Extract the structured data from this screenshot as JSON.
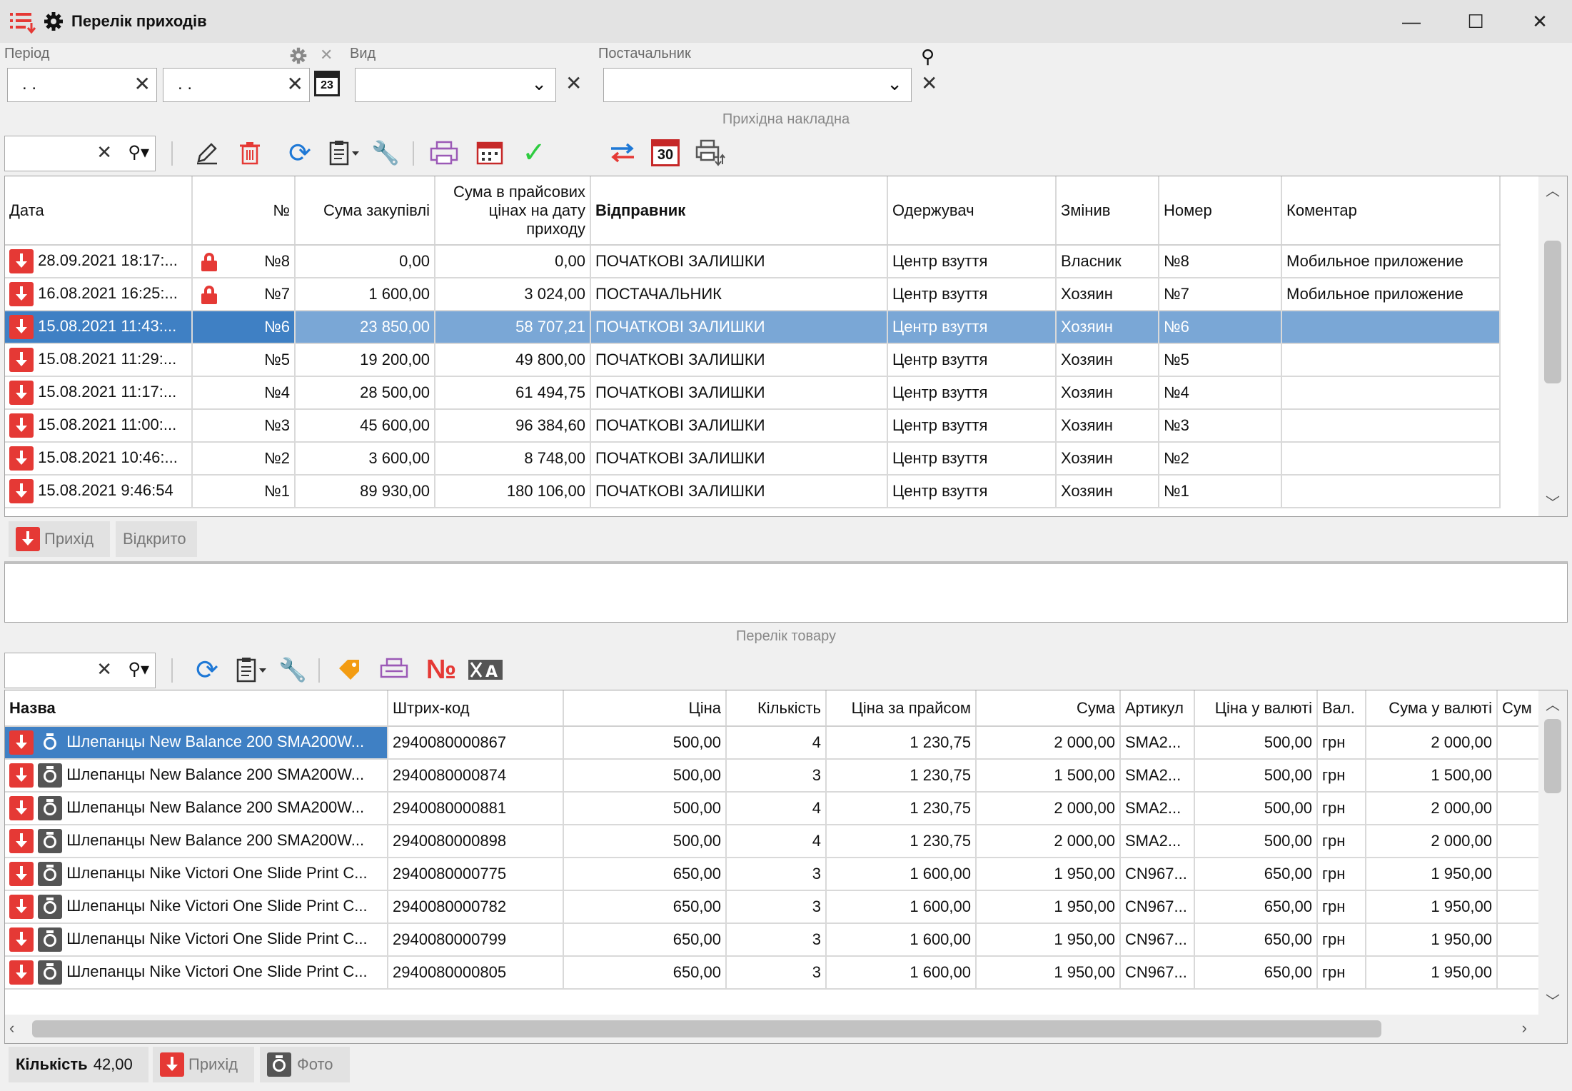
{
  "window": {
    "title": "Перелік приходів"
  },
  "filters": {
    "period_label": "Період",
    "period_from": ". .",
    "period_to": ". .",
    "calendar_day": "23",
    "kind_label": "Вид",
    "kind_value": "",
    "supplier_label": "Постачальник",
    "supplier_value": ""
  },
  "invoice_section": {
    "title": "Прихідна накладна",
    "search_value": "",
    "report_day": "30"
  },
  "invoices": {
    "columns": [
      "Дата",
      "№",
      "Сума закупівлі",
      "Сума в прайсових цінах на дату приходу",
      "Відправник",
      "Одержувач",
      "Змінив",
      "Номер",
      "Коментар"
    ],
    "rows": [
      {
        "date": "28.09.2021 18:17:...",
        "locked": true,
        "no": "№8",
        "purchase": "0,00",
        "price_sum": "0,00",
        "sender": "ПОЧАТКОВІ ЗАЛИШКИ",
        "receiver": "Центр взуття",
        "changed": "Власник",
        "number": "№8",
        "comment": "Мобильное приложение"
      },
      {
        "date": "16.08.2021 16:25:...",
        "locked": true,
        "no": "№7",
        "purchase": "1 600,00",
        "price_sum": "3 024,00",
        "sender": "ПОСТАЧАЛЬНИК",
        "receiver": "Центр взуття",
        "changed": "Хозяин",
        "number": "№7",
        "comment": "Мобильное приложение"
      },
      {
        "date": "15.08.2021 11:43:...",
        "locked": false,
        "selected": true,
        "no": "№6",
        "purchase": "23 850,00",
        "price_sum": "58 707,21",
        "sender": "ПОЧАТКОВІ ЗАЛИШКИ",
        "receiver": "Центр взуття",
        "changed": "Хозяин",
        "number": "№6",
        "comment": ""
      },
      {
        "date": "15.08.2021 11:29:...",
        "locked": false,
        "no": "№5",
        "purchase": "19 200,00",
        "price_sum": "49 800,00",
        "sender": "ПОЧАТКОВІ ЗАЛИШКИ",
        "receiver": "Центр взуття",
        "changed": "Хозяин",
        "number": "№5",
        "comment": ""
      },
      {
        "date": "15.08.2021 11:17:...",
        "locked": false,
        "no": "№4",
        "purchase": "28 500,00",
        "price_sum": "61 494,75",
        "sender": "ПОЧАТКОВІ ЗАЛИШКИ",
        "receiver": "Центр взуття",
        "changed": "Хозяин",
        "number": "№4",
        "comment": ""
      },
      {
        "date": "15.08.2021 11:00:...",
        "locked": false,
        "no": "№3",
        "purchase": "45 600,00",
        "price_sum": "96 384,60",
        "sender": "ПОЧАТКОВІ ЗАЛИШКИ",
        "receiver": "Центр взуття",
        "changed": "Хозяин",
        "number": "№3",
        "comment": ""
      },
      {
        "date": "15.08.2021 10:46:...",
        "locked": false,
        "no": "№2",
        "purchase": "3 600,00",
        "price_sum": "8 748,00",
        "sender": "ПОЧАТКОВІ ЗАЛИШКИ",
        "receiver": "Центр взуття",
        "changed": "Хозяин",
        "number": "№2",
        "comment": ""
      },
      {
        "date": "15.08.2021 9:46:54",
        "locked": false,
        "no": "№1",
        "purchase": "89 930,00",
        "price_sum": "180 106,00",
        "sender": "ПОЧАТКОВІ ЗАЛИШКИ",
        "receiver": "Центр взуття",
        "changed": "Хозяин",
        "number": "№1",
        "comment": ""
      }
    ]
  },
  "invoice_tags": {
    "income": "Прихід",
    "open": "Відкрито"
  },
  "goods_section": {
    "title": "Перелік товару",
    "search_value": ""
  },
  "goods": {
    "columns": [
      "Назва",
      "Штрих-код",
      "Ціна",
      "Кількість",
      "Ціна за прайсом",
      "Сума",
      "Артикул",
      "Ціна у валюті",
      "Вал.",
      "Сума у валюті",
      "Сум"
    ],
    "rows": [
      {
        "name": "Шлепанцы New Balance 200 SMA200W...",
        "barcode": "2940080000867",
        "price": "500,00",
        "qty": "4",
        "list_price": "1 230,75",
        "sum": "2 000,00",
        "article": "SMA2...",
        "cur_price": "500,00",
        "cur": "грн",
        "cur_sum": "2 000,00",
        "selected": true
      },
      {
        "name": "Шлепанцы New Balance 200 SMA200W...",
        "barcode": "2940080000874",
        "price": "500,00",
        "qty": "3",
        "list_price": "1 230,75",
        "sum": "1 500,00",
        "article": "SMA2...",
        "cur_price": "500,00",
        "cur": "грн",
        "cur_sum": "1 500,00"
      },
      {
        "name": "Шлепанцы New Balance 200 SMA200W...",
        "barcode": "2940080000881",
        "price": "500,00",
        "qty": "4",
        "list_price": "1 230,75",
        "sum": "2 000,00",
        "article": "SMA2...",
        "cur_price": "500,00",
        "cur": "грн",
        "cur_sum": "2 000,00"
      },
      {
        "name": "Шлепанцы New Balance 200 SMA200W...",
        "barcode": "2940080000898",
        "price": "500,00",
        "qty": "4",
        "list_price": "1 230,75",
        "sum": "2 000,00",
        "article": "SMA2...",
        "cur_price": "500,00",
        "cur": "грн",
        "cur_sum": "2 000,00"
      },
      {
        "name": "Шлепанцы Nike Victori One Slide Print C...",
        "barcode": "2940080000775",
        "price": "650,00",
        "qty": "3",
        "list_price": "1 600,00",
        "sum": "1 950,00",
        "article": "CN967...",
        "cur_price": "650,00",
        "cur": "грн",
        "cur_sum": "1 950,00"
      },
      {
        "name": "Шлепанцы Nike Victori One Slide Print C...",
        "barcode": "2940080000782",
        "price": "650,00",
        "qty": "3",
        "list_price": "1 600,00",
        "sum": "1 950,00",
        "article": "CN967...",
        "cur_price": "650,00",
        "cur": "грн",
        "cur_sum": "1 950,00"
      },
      {
        "name": "Шлепанцы Nike Victori One Slide Print C...",
        "barcode": "2940080000799",
        "price": "650,00",
        "qty": "3",
        "list_price": "1 600,00",
        "sum": "1 950,00",
        "article": "CN967...",
        "cur_price": "650,00",
        "cur": "грн",
        "cur_sum": "1 950,00"
      },
      {
        "name": "Шлепанцы Nike Victori One Slide Print C...",
        "barcode": "2940080000805",
        "price": "650,00",
        "qty": "3",
        "list_price": "1 600,00",
        "sum": "1 950,00",
        "article": "CN967...",
        "cur_price": "650,00",
        "cur": "грн",
        "cur_sum": "1 950,00"
      }
    ]
  },
  "footer": {
    "qty_label": "Кількість",
    "qty_value": "42,00",
    "income": "Прихід",
    "photo": "Фото"
  },
  "icons": {
    "menu": "list-menu-icon",
    "settings": "gear-icon",
    "calendar": "calendar-icon",
    "search": "search-icon"
  },
  "colors": {
    "accent_red": "#e53935",
    "selection": "#7aa7d6",
    "selection_dark": "#3f80c4"
  }
}
